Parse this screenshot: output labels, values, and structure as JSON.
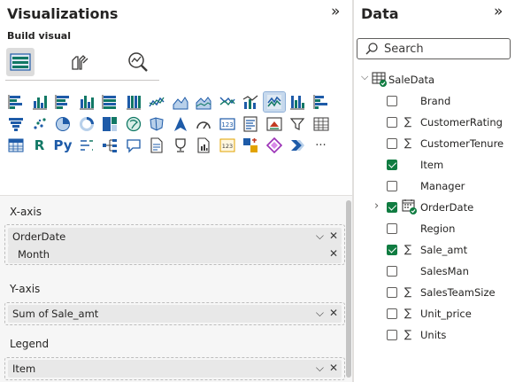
{
  "visualizations": {
    "title": "Visualizations",
    "build_visual_label": "Build visual",
    "gallery": [
      "stacked-bar",
      "stacked-column",
      "clustered-bar",
      "clustered-column",
      "100-stacked-bar",
      "100-stacked-column",
      "line",
      "area",
      "stacked-area",
      "100-stacked-area",
      "line-clustered-column",
      "line-stacked-column",
      "ribbon",
      "waterfall",
      "funnel",
      "scatter",
      "pie",
      "donut",
      "treemap",
      "map",
      "filled-map",
      "azure-map",
      "gauge",
      "card",
      "multi-row-card",
      "kpi",
      "slicer",
      "table",
      "matrix",
      "r-visual",
      "python-visual",
      "key-influencers",
      "decomposition-tree",
      "qa",
      "smart-narrative",
      "paginated-report",
      "metrics",
      "power-automate",
      "power-apps",
      "dataverse",
      "arrow-visual",
      "more"
    ],
    "r_text": "R",
    "py_text": "Py",
    "more_text": "···",
    "wells": {
      "x_axis": {
        "label": "X-axis",
        "field": "OrderDate",
        "sub": "Month"
      },
      "y_axis": {
        "label": "Y-axis",
        "field": "Sum of Sale_amt"
      },
      "legend": {
        "label": "Legend",
        "field": "Item"
      }
    }
  },
  "data_pane": {
    "title": "Data",
    "search_placeholder": "Search",
    "table_name": "SaleData",
    "fields": [
      {
        "name": "Brand",
        "checked": false,
        "sigma": false
      },
      {
        "name": "CustomerRating",
        "checked": false,
        "sigma": true
      },
      {
        "name": "CustomerTenure",
        "checked": false,
        "sigma": true
      },
      {
        "name": "Item",
        "checked": true,
        "sigma": false
      },
      {
        "name": "Manager",
        "checked": false,
        "sigma": false
      },
      {
        "name": "OrderDate",
        "checked": true,
        "sigma": false,
        "hierarchy": true
      },
      {
        "name": "Region",
        "checked": false,
        "sigma": false
      },
      {
        "name": "Sale_amt",
        "checked": true,
        "sigma": true
      },
      {
        "name": "SalesMan",
        "checked": false,
        "sigma": false
      },
      {
        "name": "SalesTeamSize",
        "checked": false,
        "sigma": true
      },
      {
        "name": "Unit_price",
        "checked": false,
        "sigma": true
      },
      {
        "name": "Units",
        "checked": false,
        "sigma": true
      }
    ]
  },
  "colors": {
    "accent": "#107c41",
    "selected_bg": "#c7d9ed",
    "icon_blue": "#1e5ba8",
    "icon_teal": "#117865"
  }
}
